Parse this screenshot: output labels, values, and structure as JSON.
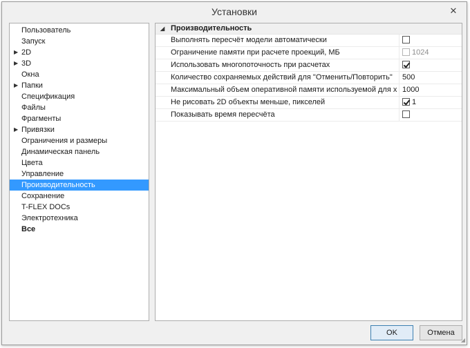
{
  "window": {
    "title": "Установки",
    "close_glyph": "✕"
  },
  "tree": {
    "items": [
      {
        "label": "Пользователь",
        "expandable": false,
        "selected": false,
        "bold": false
      },
      {
        "label": "Запуск",
        "expandable": false,
        "selected": false,
        "bold": false
      },
      {
        "label": "2D",
        "expandable": true,
        "selected": false,
        "bold": false
      },
      {
        "label": "3D",
        "expandable": true,
        "selected": false,
        "bold": false
      },
      {
        "label": "Окна",
        "expandable": false,
        "selected": false,
        "bold": false
      },
      {
        "label": "Папки",
        "expandable": true,
        "selected": false,
        "bold": false
      },
      {
        "label": "Спецификация",
        "expandable": false,
        "selected": false,
        "bold": false
      },
      {
        "label": "Файлы",
        "expandable": false,
        "selected": false,
        "bold": false
      },
      {
        "label": "Фрагменты",
        "expandable": false,
        "selected": false,
        "bold": false
      },
      {
        "label": "Привязки",
        "expandable": true,
        "selected": false,
        "bold": false
      },
      {
        "label": "Ограничения и размеры",
        "expandable": false,
        "selected": false,
        "bold": false
      },
      {
        "label": "Динамическая панель",
        "expandable": false,
        "selected": false,
        "bold": false
      },
      {
        "label": "Цвета",
        "expandable": false,
        "selected": false,
        "bold": false
      },
      {
        "label": "Управление",
        "expandable": false,
        "selected": false,
        "bold": false
      },
      {
        "label": "Производительность",
        "expandable": false,
        "selected": true,
        "bold": false
      },
      {
        "label": "Сохранение",
        "expandable": false,
        "selected": false,
        "bold": false
      },
      {
        "label": "T-FLEX DOCs",
        "expandable": false,
        "selected": false,
        "bold": false
      },
      {
        "label": "Электротехника",
        "expandable": false,
        "selected": false,
        "bold": false
      },
      {
        "label": "Все",
        "expandable": false,
        "selected": false,
        "bold": true
      }
    ],
    "expand_glyph": "▶"
  },
  "properties": {
    "category": "Производительность",
    "collapse_glyph": "◢",
    "rows": [
      {
        "name": "Выполнять пересчёт модели автоматически",
        "checkbox": true,
        "checked": false,
        "disabled": false,
        "text": ""
      },
      {
        "name": "Ограничение памяти при расчете проекций, МБ",
        "checkbox": true,
        "checked": false,
        "disabled": true,
        "text": "1024"
      },
      {
        "name": "Использовать многопоточность при расчетах",
        "checkbox": true,
        "checked": true,
        "disabled": false,
        "text": ""
      },
      {
        "name": "Количество сохраняемых действий для \"Отменить/Повторить\"",
        "checkbox": false,
        "checked": false,
        "disabled": false,
        "text": "500"
      },
      {
        "name": "Максимальный объем оперативной памяти используемой для хра",
        "checkbox": false,
        "checked": false,
        "disabled": false,
        "text": "1000"
      },
      {
        "name": "Не рисовать 2D объекты меньше, пикселей",
        "checkbox": true,
        "checked": true,
        "disabled": false,
        "text": "1"
      },
      {
        "name": "Показывать время пересчёта",
        "checkbox": true,
        "checked": false,
        "disabled": false,
        "text": ""
      }
    ]
  },
  "buttons": {
    "ok_label": "OK",
    "cancel_label": "Отмена"
  },
  "colors": {
    "selection": "#3399ff",
    "window_bg": "#f0f0f0"
  }
}
